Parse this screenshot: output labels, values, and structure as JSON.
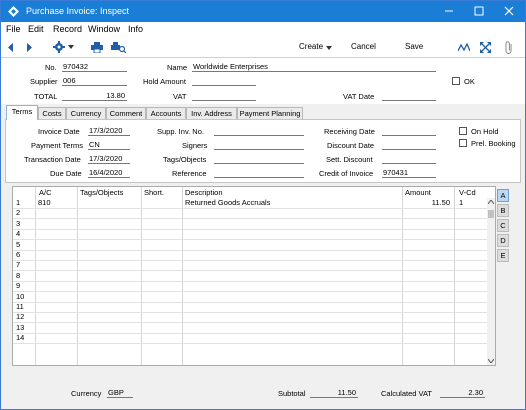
{
  "window": {
    "title": "Purchase Invoice: Inspect"
  },
  "menu": [
    "File",
    "Edit",
    "Record",
    "Window",
    "Info"
  ],
  "toolbar": {
    "create": "Create",
    "cancel": "Cancel",
    "save": "Save"
  },
  "header": {
    "no_label": "No.",
    "no_value": "970432",
    "name_label": "Name",
    "name_value": "Worldwide Enterprises",
    "supplier_label": "Supplier",
    "supplier_value": "006",
    "hold_amount_label": "Hold Amount",
    "hold_amount_value": "",
    "ok_label": "OK",
    "total_label": "TOTAL",
    "total_value": "13.80",
    "vat_label": "VAT",
    "vat_value": "",
    "vat_date_label": "VAT Date",
    "vat_date_value": ""
  },
  "tabs": [
    "Terms",
    "Costs",
    "Currency",
    "Comment",
    "Accounts",
    "Inv. Address",
    "Payment Planning"
  ],
  "terms": {
    "invoice_date_label": "Invoice Date",
    "invoice_date": "17/3/2020",
    "payment_terms_label": "Payment Terms",
    "payment_terms": "CN",
    "transaction_date_label": "Transaction Date",
    "transaction_date": "17/3/2020",
    "due_date_label": "Due Date",
    "due_date": "16/4/2020",
    "supp_inv_no_label": "Supp. Inv. No.",
    "supp_inv_no": "",
    "signers_label": "Signers",
    "signers": "",
    "tags_label": "Tags/Objects",
    "tags": "",
    "reference_label": "Reference",
    "reference": "",
    "receiving_date_label": "Receiving Date",
    "receiving_date": "",
    "discount_date_label": "Discount Date",
    "discount_date": "",
    "sett_discount_label": "Sett. Discount",
    "sett_discount": "",
    "credit_of_invoice_label": "Credit of Invoice",
    "credit_of_invoice": "970431",
    "on_hold_label": "On Hold",
    "prel_booking_label": "Prel. Booking"
  },
  "grid": {
    "columns": [
      "A/C",
      "Tags/Objects",
      "Short.",
      "Description",
      "Amount",
      "V-Cd"
    ],
    "rows": [
      {
        "n": "1",
        "ac": "810",
        "tags": "",
        "short": "",
        "desc": "Returned Goods Accruals",
        "amount": "11.50",
        "vcd": "1"
      },
      {
        "n": "2"
      },
      {
        "n": "3"
      },
      {
        "n": "4"
      },
      {
        "n": "5"
      },
      {
        "n": "6"
      },
      {
        "n": "7"
      },
      {
        "n": "8"
      },
      {
        "n": "9"
      },
      {
        "n": "10"
      },
      {
        "n": "11"
      },
      {
        "n": "12"
      },
      {
        "n": "13"
      },
      {
        "n": "14"
      }
    ],
    "side_tabs": [
      "A",
      "B",
      "C",
      "D",
      "E"
    ]
  },
  "footer": {
    "currency_label": "Currency",
    "currency": "GBP",
    "subtotal_label": "Subtotal",
    "subtotal": "11.50",
    "calc_vat_label": "Calculated VAT",
    "calc_vat": "2.30"
  }
}
